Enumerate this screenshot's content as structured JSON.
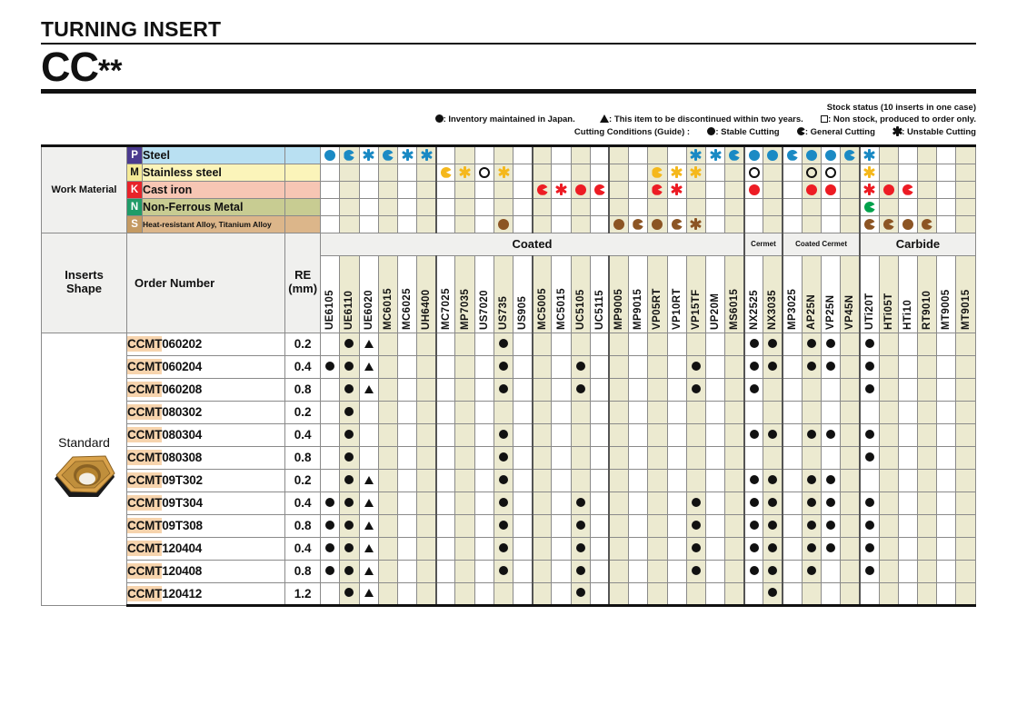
{
  "header": {
    "title": "TURNING INSERT",
    "code": "CC",
    "code_asterisks": "**"
  },
  "legend": {
    "stock_status": "Stock status (10 inserts in one case)",
    "inventory": ": Inventory maintained in Japan.",
    "discontinued": ": This item to be discontinued within two years.",
    "non_stock": ": Non stock, produced to order only.",
    "cutting_conditions": "Cutting Conditions (Guide) :",
    "stable": ": Stable Cutting",
    "general": ": General Cutting",
    "unstable": ": Unstable Cutting"
  },
  "work_material": {
    "label": "Work Material",
    "rows": [
      {
        "mark": "P",
        "name": "Steel",
        "small": false,
        "mark_class": "mk-p",
        "row_class": "r-p",
        "color": "#1b8ac4"
      },
      {
        "mark": "M",
        "name": "Stainless steel",
        "small": false,
        "mark_class": "mk-m",
        "row_class": "r-m",
        "color": "#f5b81c"
      },
      {
        "mark": "K",
        "name": "Cast iron",
        "small": false,
        "mark_class": "mk-k",
        "row_class": "r-k",
        "color": "#ed1c24"
      },
      {
        "mark": "N",
        "name": "Non-Ferrous Metal",
        "small": false,
        "mark_class": "mk-n",
        "row_class": "r-n",
        "color": "#00a14b"
      },
      {
        "mark": "S",
        "name": "Heat-resistant Alloy, Titanium Alloy",
        "small": true,
        "mark_class": "mk-s",
        "row_class": "r-s",
        "color": "#8c5524"
      }
    ]
  },
  "table_headers": {
    "inserts_shape": "Inserts\nShape",
    "inserts_shape_l1": "Inserts",
    "inserts_shape_l2": "Shape",
    "order_number": "Order Number",
    "re_l1": "RE",
    "re_l2": "(mm)"
  },
  "categories": [
    {
      "label": "Coated",
      "span": 22,
      "small": false
    },
    {
      "label": "Cermet",
      "span": 2,
      "small": true
    },
    {
      "label": "Coated Cermet",
      "span": 4,
      "small": true
    },
    {
      "label": "Carbide",
      "span": 6,
      "small": false
    }
  ],
  "grades": [
    "UE6105",
    "UE6110",
    "UE6020",
    "MC6015",
    "MC6025",
    "UH6400",
    "MC7025",
    "MP7035",
    "US7020",
    "US735",
    "US905",
    "MC5005",
    "MC5015",
    "UC5105",
    "UC5115",
    "MP9005",
    "MP9015",
    "VP05RT",
    "VP10RT",
    "VP15TF",
    "UP20M",
    "MS6015",
    "NX2525",
    "NX3035",
    "MP3025",
    "AP25N",
    "VP25N",
    "VP45N",
    "UTi20T",
    "HTi05T",
    "HTi10",
    "RT9010",
    "MT9005",
    "MT9015"
  ],
  "group_separator_indices": [
    6,
    11,
    15,
    22,
    24,
    28
  ],
  "work_material_marks": {
    "P": {
      "0": "full",
      "1": "half",
      "2": "star",
      "3": "half",
      "4": "star",
      "5": "star",
      "19": "star",
      "20": "star",
      "21": "half",
      "22": "full",
      "23": "full",
      "24": "half",
      "25": "full",
      "26": "full",
      "27": "half",
      "28": "star"
    },
    "M": {
      "6": "half",
      "7": "star",
      "8": "ring",
      "9": "star",
      "17": "half",
      "18": "star",
      "19": "star",
      "22": "ring",
      "25": "ring",
      "26": "ring",
      "28": "star"
    },
    "K": {
      "11": "half",
      "12": "star",
      "13": "full",
      "14": "half",
      "17": "half",
      "18": "star",
      "22": "full",
      "25": "full",
      "26": "full",
      "28": "star",
      "29": "full",
      "30": "half"
    },
    "N": {
      "28": "half"
    },
    "S": {
      "9": "full",
      "15": "full",
      "16": "half",
      "17": "full",
      "18": "half",
      "19": "star",
      "28": "half",
      "29": "half",
      "30": "full",
      "31": "half"
    }
  },
  "shape": {
    "label": "Standard"
  },
  "rows": [
    {
      "order_prefix": "CCMT",
      "order_suffix": "060202",
      "re": "0.2",
      "dots": [
        1,
        9,
        22,
        23,
        25,
        26,
        28
      ],
      "tris": [
        2
      ]
    },
    {
      "order_prefix": "CCMT",
      "order_suffix": "060204",
      "re": "0.4",
      "dots": [
        0,
        1,
        9,
        13,
        19,
        22,
        23,
        25,
        26,
        28
      ],
      "tris": [
        2
      ]
    },
    {
      "order_prefix": "CCMT",
      "order_suffix": "060208",
      "re": "0.8",
      "dots": [
        1,
        9,
        13,
        19,
        22,
        28
      ],
      "tris": [
        2
      ]
    },
    {
      "order_prefix": "CCMT",
      "order_suffix": "080302",
      "re": "0.2",
      "dots": [
        1
      ],
      "tris": []
    },
    {
      "order_prefix": "CCMT",
      "order_suffix": "080304",
      "re": "0.4",
      "dots": [
        1,
        9,
        22,
        23,
        25,
        26,
        28
      ],
      "tris": []
    },
    {
      "order_prefix": "CCMT",
      "order_suffix": "080308",
      "re": "0.8",
      "dots": [
        1,
        9,
        28
      ],
      "tris": []
    },
    {
      "order_prefix": "CCMT",
      "order_suffix": "09T302",
      "re": "0.2",
      "dots": [
        1,
        9,
        22,
        23,
        25,
        26
      ],
      "tris": [
        2
      ]
    },
    {
      "order_prefix": "CCMT",
      "order_suffix": "09T304",
      "re": "0.4",
      "dots": [
        0,
        1,
        9,
        13,
        19,
        22,
        23,
        25,
        26,
        28
      ],
      "tris": [
        2
      ]
    },
    {
      "order_prefix": "CCMT",
      "order_suffix": "09T308",
      "re": "0.8",
      "dots": [
        0,
        1,
        9,
        13,
        19,
        22,
        23,
        25,
        26,
        28
      ],
      "tris": [
        2
      ]
    },
    {
      "order_prefix": "CCMT",
      "order_suffix": "120404",
      "re": "0.4",
      "dots": [
        0,
        1,
        9,
        13,
        19,
        22,
        23,
        25,
        26,
        28
      ],
      "tris": [
        2
      ]
    },
    {
      "order_prefix": "CCMT",
      "order_suffix": "120408",
      "re": "0.8",
      "dots": [
        0,
        1,
        9,
        13,
        19,
        22,
        23,
        25,
        28
      ],
      "tris": [
        2
      ]
    },
    {
      "order_prefix": "CCMT",
      "order_suffix": "120412",
      "re": "1.2",
      "dots": [
        1,
        13,
        23
      ],
      "tris": [
        2
      ]
    }
  ]
}
